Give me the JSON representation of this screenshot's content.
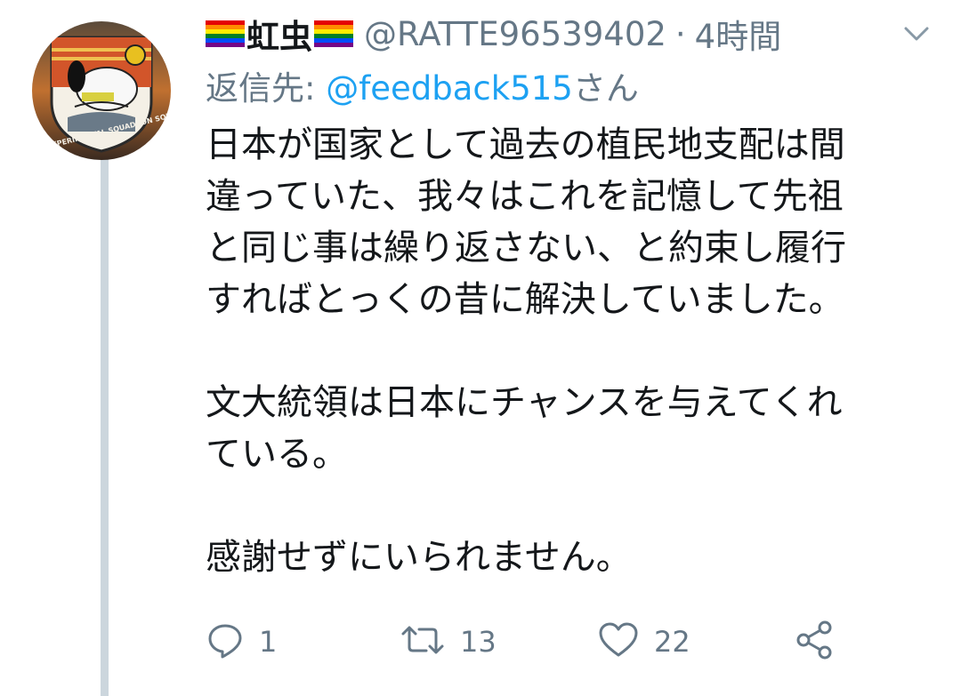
{
  "tweet": {
    "display_name": "虹虫",
    "handle": "@RATTE96539402",
    "separator": "·",
    "timestamp": "4時間",
    "reply_prefix": "返信先: ",
    "reply_to": "@feedback515",
    "reply_suffix": "さん",
    "body_lines": [
      "日本が国家として過去の植民地支配は間",
      "違っていた、我々はこれを記憶して先祖",
      "と同じ事は繰り返さない、と約束し履行",
      "すればとっくの昔に解決していました。",
      "",
      "文大統領は日本にチャンスを与えてくれ",
      "ている。",
      "",
      "感謝せずにいられません。"
    ],
    "avatar_text": "8th EXPERIMENTAL SQUADRON SQL"
  },
  "actions": {
    "reply_count": "1",
    "retweet_count": "13",
    "like_count": "22"
  },
  "colors": {
    "text": "#14171a",
    "secondary": "#657786",
    "link": "#1da1f2",
    "thread_line": "#ccd6dd"
  },
  "icons": {
    "flag_left": "rainbow-flag-icon",
    "flag_right": "rainbow-flag-icon",
    "menu": "chevron-down-icon",
    "reply": "reply-icon",
    "retweet": "retweet-icon",
    "like": "heart-icon",
    "share": "share-icon"
  }
}
